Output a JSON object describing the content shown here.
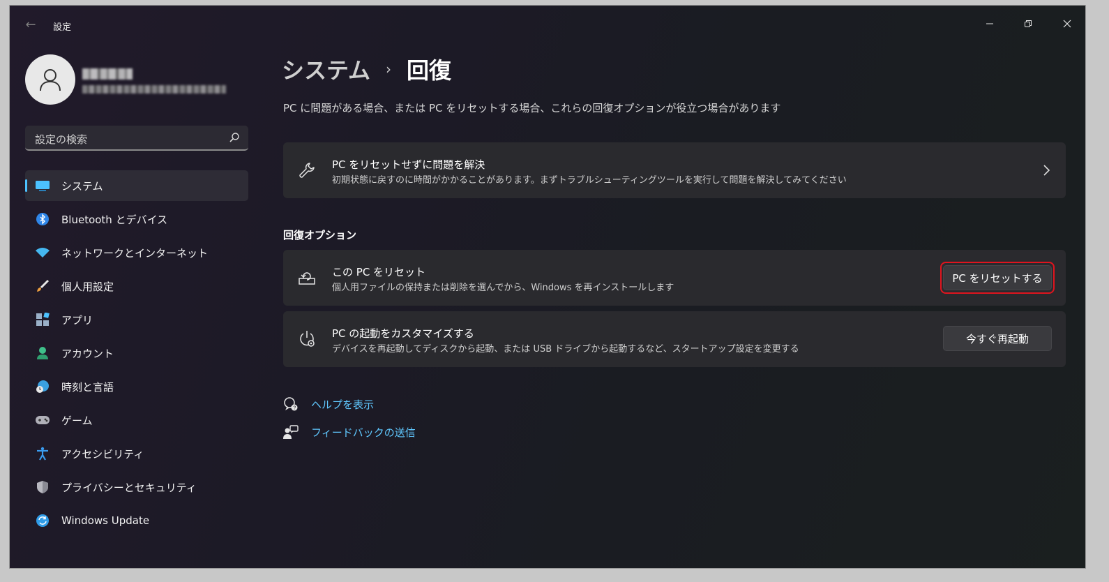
{
  "window": {
    "title": "設定",
    "controls": {
      "minimize": "minimize",
      "maximize": "maximize",
      "close": "close"
    }
  },
  "search": {
    "placeholder": "設定の検索"
  },
  "sidebar": {
    "items": [
      {
        "label": "システム",
        "icon": "system-icon",
        "selected": true,
        "color": "#4cc2ff"
      },
      {
        "label": "Bluetooth とデバイス",
        "icon": "bluetooth-icon",
        "color": "#3a8ef0"
      },
      {
        "label": "ネットワークとインターネット",
        "icon": "wifi-icon",
        "color": "#45b7f0"
      },
      {
        "label": "個人用設定",
        "icon": "brush-icon",
        "color": "#f0a040"
      },
      {
        "label": "アプリ",
        "icon": "apps-icon",
        "color": "#9ab0c8"
      },
      {
        "label": "アカウント",
        "icon": "account-icon",
        "color": "#3fc08a"
      },
      {
        "label": "時刻と言語",
        "icon": "globe-clock-icon",
        "color": "#3aa0e0"
      },
      {
        "label": "ゲーム",
        "icon": "gamepad-icon",
        "color": "#b0b0b8"
      },
      {
        "label": "アクセシビリティ",
        "icon": "accessibility-icon",
        "color": "#3a9cf0"
      },
      {
        "label": "プライバシーとセキュリティ",
        "icon": "shield-icon",
        "color": "#b8b8c0"
      },
      {
        "label": "Windows Update",
        "icon": "update-icon",
        "color": "#2f9ce8"
      }
    ]
  },
  "main": {
    "breadcrumb": {
      "parent": "システム",
      "separator": "›",
      "current": "回復"
    },
    "description": "PC に問題がある場合、または PC をリセットする場合、これらの回復オプションが役立つ場合があります",
    "troubleshoot": {
      "title": "PC をリセットせずに問題を解決",
      "subtitle": "初期状態に戻すのに時間がかかることがあります。まずトラブルシューティングツールを実行して問題を解決してみてください"
    },
    "section_title": "回復オプション",
    "reset": {
      "title": "この PC をリセット",
      "subtitle": "個人用ファイルの保持または削除を選んでから、Windows を再インストールします",
      "button": "PC をリセットする"
    },
    "startup": {
      "title": "PC の起動をカスタマイズする",
      "subtitle": "デバイスを再起動してディスクから起動、または USB ドライブから起動するなど、スタートアップ設定を変更する",
      "button": "今すぐ再起動"
    },
    "links": {
      "help": "ヘルプを表示",
      "feedback": "フィードバックの送信"
    }
  },
  "colors": {
    "accent": "#4cc2ff",
    "link": "#60c8ff",
    "highlight": "#e0141e"
  }
}
